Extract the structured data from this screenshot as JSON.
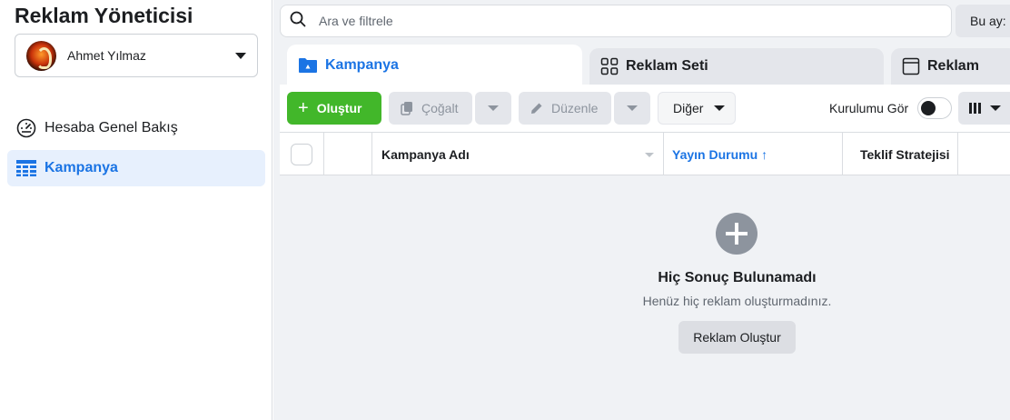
{
  "app": {
    "title": "Reklam Yöneticisi"
  },
  "account": {
    "name": "Ahmet Yılmaz"
  },
  "sidebar": {
    "items": [
      {
        "label": "Hesaba Genel Bakış",
        "icon": "gauge-icon"
      },
      {
        "label": "Kampanya",
        "icon": "table-icon"
      }
    ]
  },
  "search": {
    "placeholder": "Ara ve filtrele"
  },
  "date_filter": {
    "label": "Bu ay:"
  },
  "tabs": [
    {
      "label": "Kampanya",
      "icon": "folder-icon"
    },
    {
      "label": "Reklam Seti",
      "icon": "grid-icon"
    },
    {
      "label": "Reklam",
      "icon": "window-icon"
    }
  ],
  "toolbar": {
    "create_label": "Oluştur",
    "duplicate_label": "Çoğalt",
    "edit_label": "Düzenle",
    "more_label": "Diğer",
    "setup_label": "Kurulumu Gör"
  },
  "table": {
    "columns": [
      "Kampanya Adı",
      "Yayın Durumu",
      "Teklif Stratejisi"
    ],
    "sort_arrow": "↑"
  },
  "empty_state": {
    "title": "Hiç Sonuç Bulunamadı",
    "subtitle": "Henüz hiç reklam oluşturmadınız.",
    "button_label": "Reklam Oluştur"
  },
  "colors": {
    "accent": "#1b74e4",
    "create_green": "#42b72a",
    "content_bg": "#f0f2f5"
  }
}
